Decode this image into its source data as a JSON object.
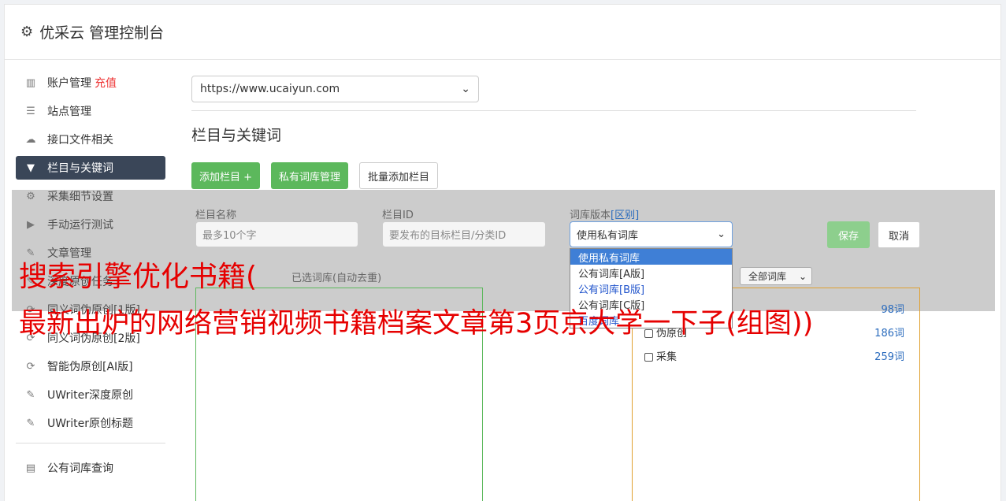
{
  "header": {
    "title": "优采云 管理控制台"
  },
  "sidebar": {
    "items": [
      {
        "icon": "bar-chart-icon",
        "label": "账户管理",
        "badge": "充值"
      },
      {
        "icon": "server-icon",
        "label": "站点管理"
      },
      {
        "icon": "cloud-upload-icon",
        "label": "接口文件相关"
      },
      {
        "icon": "filter-icon",
        "label": "栏目与关键词",
        "active": true
      },
      {
        "icon": "gears-icon",
        "label": "采集细节设置"
      },
      {
        "icon": "play-circle-icon",
        "label": "手动运行测试"
      },
      {
        "icon": "edit-icon",
        "label": "文章管理"
      },
      {
        "icon": "edit-icon",
        "label": "深度原创任务"
      },
      {
        "icon": "refresh-icon",
        "label": "同义词伪原创[1版]"
      },
      {
        "icon": "refresh-icon",
        "label": "同义词伪原创[2版]"
      },
      {
        "icon": "refresh-icon",
        "label": "智能伪原创[AI版]"
      },
      {
        "icon": "edit-icon",
        "label": "UWriter深度原创"
      },
      {
        "icon": "edit-icon",
        "label": "UWriter原创标题"
      },
      {
        "icon": "book-icon",
        "label": "公有词库查询"
      }
    ]
  },
  "main": {
    "site_select": "https://www.ucaiyun.com",
    "section_title": "栏目与关键词",
    "buttons": {
      "add_column": "添加栏目 +",
      "private_lib": "私有词库管理",
      "batch_add": "批量添加栏目"
    },
    "form": {
      "col_name_label": "栏目名称",
      "col_name_placeholder": "最多10个字",
      "col_id_label": "栏目ID",
      "col_id_placeholder": "要发布的目标栏目/分类ID",
      "version_label": "词库版本",
      "version_diff": "[区别]",
      "version_selected": "使用私有词库",
      "version_options": [
        "使用私有词库",
        "公有词库[A版]",
        "公有词库[B版]",
        "公有词库[C版]",
        "百度词库"
      ],
      "save": "保存",
      "cancel": "取消"
    },
    "selected_label": "已选词库(自动去重)",
    "lib_filter": "全部词库",
    "libraries": [
      {
        "name": "原创",
        "count": "98词"
      },
      {
        "name": "伪原创",
        "count": "186词"
      },
      {
        "name": "采集",
        "count": "259词"
      }
    ]
  },
  "watermark": {
    "line1": "搜索引擎优化书籍(",
    "line2": "最新出炉的网络营销视频书籍档案文章第3页京大学一下子(组图))"
  }
}
